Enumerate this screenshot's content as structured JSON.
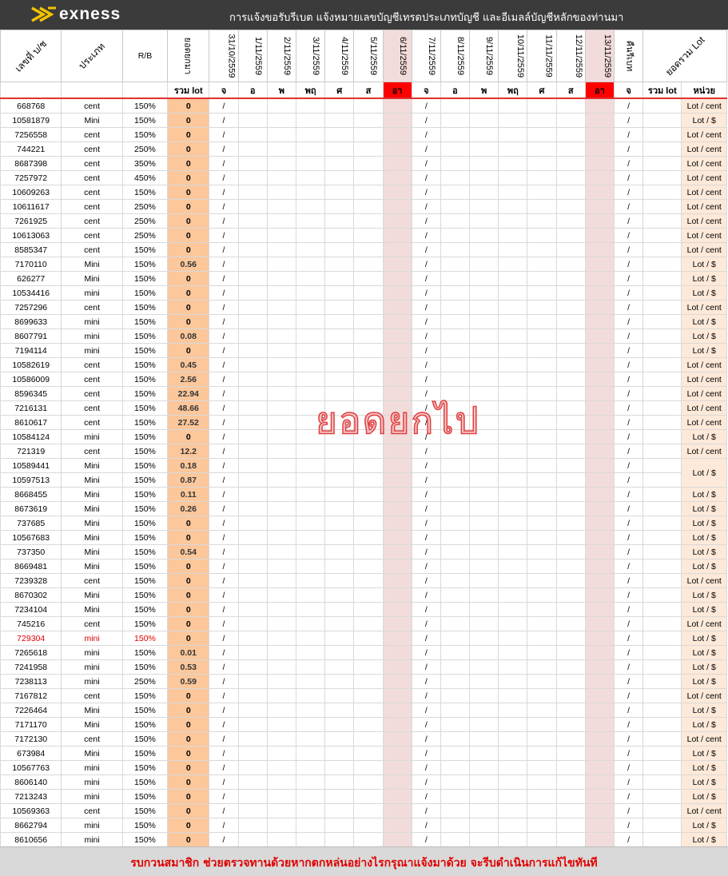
{
  "brand": {
    "logo_text": "exness",
    "title": "การแจ้งขอรับรีเบต   แจ้งหมายเลขบัญชีเทรดประเภทบัญชี และอีเมลล์บัญชีหลักของท่านมา"
  },
  "headers": {
    "account": "เลขที่ บ/ช",
    "type": "ประเภท",
    "rb": "R/B",
    "carry": "ยอดยกมา",
    "carry_date": "31/10/2559",
    "dates": [
      "1/11/2559",
      "2/11/2559",
      "3/11/2559",
      "4/11/2559",
      "5/11/2559",
      "6/11/2559",
      "7/11/2559",
      "8/11/2559",
      "9/11/2559",
      "10/11/2559",
      "11/11/2559",
      "12/11/2559",
      "13/11/2559"
    ],
    "rebate": "คืนรีเบท",
    "total": "ยอดรวม Lot"
  },
  "subheaders": {
    "sum_lot": "รวม lot",
    "carry_day": "จ",
    "days": [
      "อ",
      "พ",
      "พฤ",
      "ศ",
      "ส",
      "อา",
      "จ",
      "อ",
      "พ",
      "พฤ",
      "ศ",
      "ส",
      "อา"
    ],
    "rebate_day": "จ",
    "sum_lot2": "รวม lot",
    "unit": "หน่วย"
  },
  "mark": "/",
  "watermark": "ยอดยกไป",
  "footer": "รบกวนสมาชิก ช่วยตรวจทานด้วยหากตกหล่นอย่างไรกรุณาแจ้งมาด้วย จะรีบดำเนินการแก้ไขทันที",
  "rows": [
    {
      "acc": "668768",
      "type": "cent",
      "rb": "150%",
      "lot": "0",
      "unit": "Lot / cent"
    },
    {
      "acc": "10581879",
      "type": "Mini",
      "rb": "150%",
      "lot": "0",
      "unit": "Lot / $"
    },
    {
      "acc": "7256558",
      "type": "cent",
      "rb": "150%",
      "lot": "0",
      "unit": "Lot / cent"
    },
    {
      "acc": "744221",
      "type": "cent",
      "rb": "250%",
      "lot": "0",
      "unit": "Lot / cent"
    },
    {
      "acc": "8687398",
      "type": "cent",
      "rb": "350%",
      "lot": "0",
      "unit": "Lot / cent"
    },
    {
      "acc": "7257972",
      "type": "cent",
      "rb": "450%",
      "lot": "0",
      "unit": "Lot / cent"
    },
    {
      "acc": "10609263",
      "type": "cent",
      "rb": "150%",
      "lot": "0",
      "unit": "Lot / cent"
    },
    {
      "acc": "10611617",
      "type": "cent",
      "rb": "250%",
      "lot": "0",
      "unit": "Lot / cent"
    },
    {
      "acc": "7261925",
      "type": "cent",
      "rb": "250%",
      "lot": "0",
      "unit": "Lot / cent"
    },
    {
      "acc": "10613063",
      "type": "cent",
      "rb": "250%",
      "lot": "0",
      "unit": "Lot / cent"
    },
    {
      "acc": "8585347",
      "type": "cent",
      "rb": "150%",
      "lot": "0",
      "unit": "Lot / cent"
    },
    {
      "acc": "7170110",
      "type": "Mini",
      "rb": "150%",
      "lot": "0.56",
      "unit": "Lot / $"
    },
    {
      "acc": "626277",
      "type": "Mini",
      "rb": "150%",
      "lot": "0",
      "unit": "Lot / $"
    },
    {
      "acc": "10534416",
      "type": "mini",
      "rb": "150%",
      "lot": "0",
      "unit": "Lot / $"
    },
    {
      "acc": "7257296",
      "type": "cent",
      "rb": "150%",
      "lot": "0",
      "unit": "Lot / cent"
    },
    {
      "acc": "8699633",
      "type": "mini",
      "rb": "150%",
      "lot": "0",
      "unit": "Lot / $"
    },
    {
      "acc": "8607791",
      "type": "mini",
      "rb": "150%",
      "lot": "0.08",
      "unit": "Lot / $"
    },
    {
      "acc": "7194114",
      "type": "mini",
      "rb": "150%",
      "lot": "0",
      "unit": "Lot / $"
    },
    {
      "acc": "10582619",
      "type": "cent",
      "rb": "150%",
      "lot": "0.45",
      "unit": "Lot / cent"
    },
    {
      "acc": "10586009",
      "type": "cent",
      "rb": "150%",
      "lot": "2.56",
      "unit": "Lot / cent"
    },
    {
      "acc": "8596345",
      "type": "cent",
      "rb": "150%",
      "lot": "22.94",
      "unit": "Lot / cent"
    },
    {
      "acc": "7216131",
      "type": "cent",
      "rb": "150%",
      "lot": "48.66",
      "unit": "Lot / cent"
    },
    {
      "acc": "8610617",
      "type": "cent",
      "rb": "150%",
      "lot": "27.52",
      "unit": "Lot / cent"
    },
    {
      "acc": "10584124",
      "type": "mini",
      "rb": "150%",
      "lot": "0",
      "unit": "Lot / $"
    },
    {
      "acc": "721319",
      "type": "cent",
      "rb": "150%",
      "lot": "12.2",
      "unit": "Lot / cent"
    },
    {
      "acc": "10589441",
      "type": "Mini",
      "rb": "150%",
      "lot": "0.18",
      "unit": "Lot / $",
      "unit_span": 2
    },
    {
      "acc": "10597513",
      "type": "Mini",
      "rb": "150%",
      "lot": "0.87"
    },
    {
      "acc": "8668455",
      "type": "Mini",
      "rb": "150%",
      "lot": "0.11",
      "unit": "Lot / $"
    },
    {
      "acc": "8673619",
      "type": "Mini",
      "rb": "150%",
      "lot": "0.26",
      "unit": "Lot / $"
    },
    {
      "acc": "737685",
      "type": "Mini",
      "rb": "150%",
      "lot": "0",
      "unit": "Lot / $"
    },
    {
      "acc": "10567683",
      "type": "Mini",
      "rb": "150%",
      "lot": "0",
      "unit": "Lot / $"
    },
    {
      "acc": "737350",
      "type": "Mini",
      "rb": "150%",
      "lot": "0.54",
      "unit": "Lot / $"
    },
    {
      "acc": "8669481",
      "type": "Mini",
      "rb": "150%",
      "lot": "0",
      "unit": "Lot / $"
    },
    {
      "acc": "7239328",
      "type": "cent",
      "rb": "150%",
      "lot": "0",
      "unit": "Lot / cent"
    },
    {
      "acc": "8670302",
      "type": "Mini",
      "rb": "150%",
      "lot": "0",
      "unit": "Lot / $"
    },
    {
      "acc": "7234104",
      "type": "Mini",
      "rb": "150%",
      "lot": "0",
      "unit": "Lot / $"
    },
    {
      "acc": "745216",
      "type": "cent",
      "rb": "150%",
      "lot": "0",
      "unit": "Lot / cent"
    },
    {
      "acc": "729304",
      "type": "mini",
      "rb": "150%",
      "lot": "0",
      "unit": "Lot / $",
      "highlight": true
    },
    {
      "acc": "7265618",
      "type": "mini",
      "rb": "150%",
      "lot": "0.01",
      "unit": "Lot / $"
    },
    {
      "acc": "7241958",
      "type": "mini",
      "rb": "150%",
      "lot": "0.53",
      "unit": "Lot / $"
    },
    {
      "acc": "7238113",
      "type": "mini",
      "rb": "250%",
      "lot": "0.59",
      "unit": "Lot / $"
    },
    {
      "acc": "7167812",
      "type": "cent",
      "rb": "150%",
      "lot": "0",
      "unit": "Lot / cent"
    },
    {
      "acc": "7226464",
      "type": "Mini",
      "rb": "150%",
      "lot": "0",
      "unit": "Lot / $"
    },
    {
      "acc": "7171170",
      "type": "Mini",
      "rb": "150%",
      "lot": "0",
      "unit": "Lot / $"
    },
    {
      "acc": "7172130",
      "type": "cent",
      "rb": "150%",
      "lot": "0",
      "unit": "Lot / cent"
    },
    {
      "acc": "673984",
      "type": "Mini",
      "rb": "150%",
      "lot": "0",
      "unit": "Lot / $"
    },
    {
      "acc": "10567763",
      "type": "mini",
      "rb": "150%",
      "lot": "0",
      "unit": "Lot / $"
    },
    {
      "acc": "8606140",
      "type": "mini",
      "rb": "150%",
      "lot": "0",
      "unit": "Lot / $"
    },
    {
      "acc": "7213243",
      "type": "mini",
      "rb": "150%",
      "lot": "0",
      "unit": "Lot / $"
    },
    {
      "acc": "10569363",
      "type": "cent",
      "rb": "150%",
      "lot": "0",
      "unit": "Lot / cent"
    },
    {
      "acc": "8662794",
      "type": "mini",
      "rb": "150%",
      "lot": "0",
      "unit": "Lot / $"
    },
    {
      "acc": "8610656",
      "type": "mini",
      "rb": "150%",
      "lot": "0",
      "unit": "Lot / $"
    }
  ]
}
